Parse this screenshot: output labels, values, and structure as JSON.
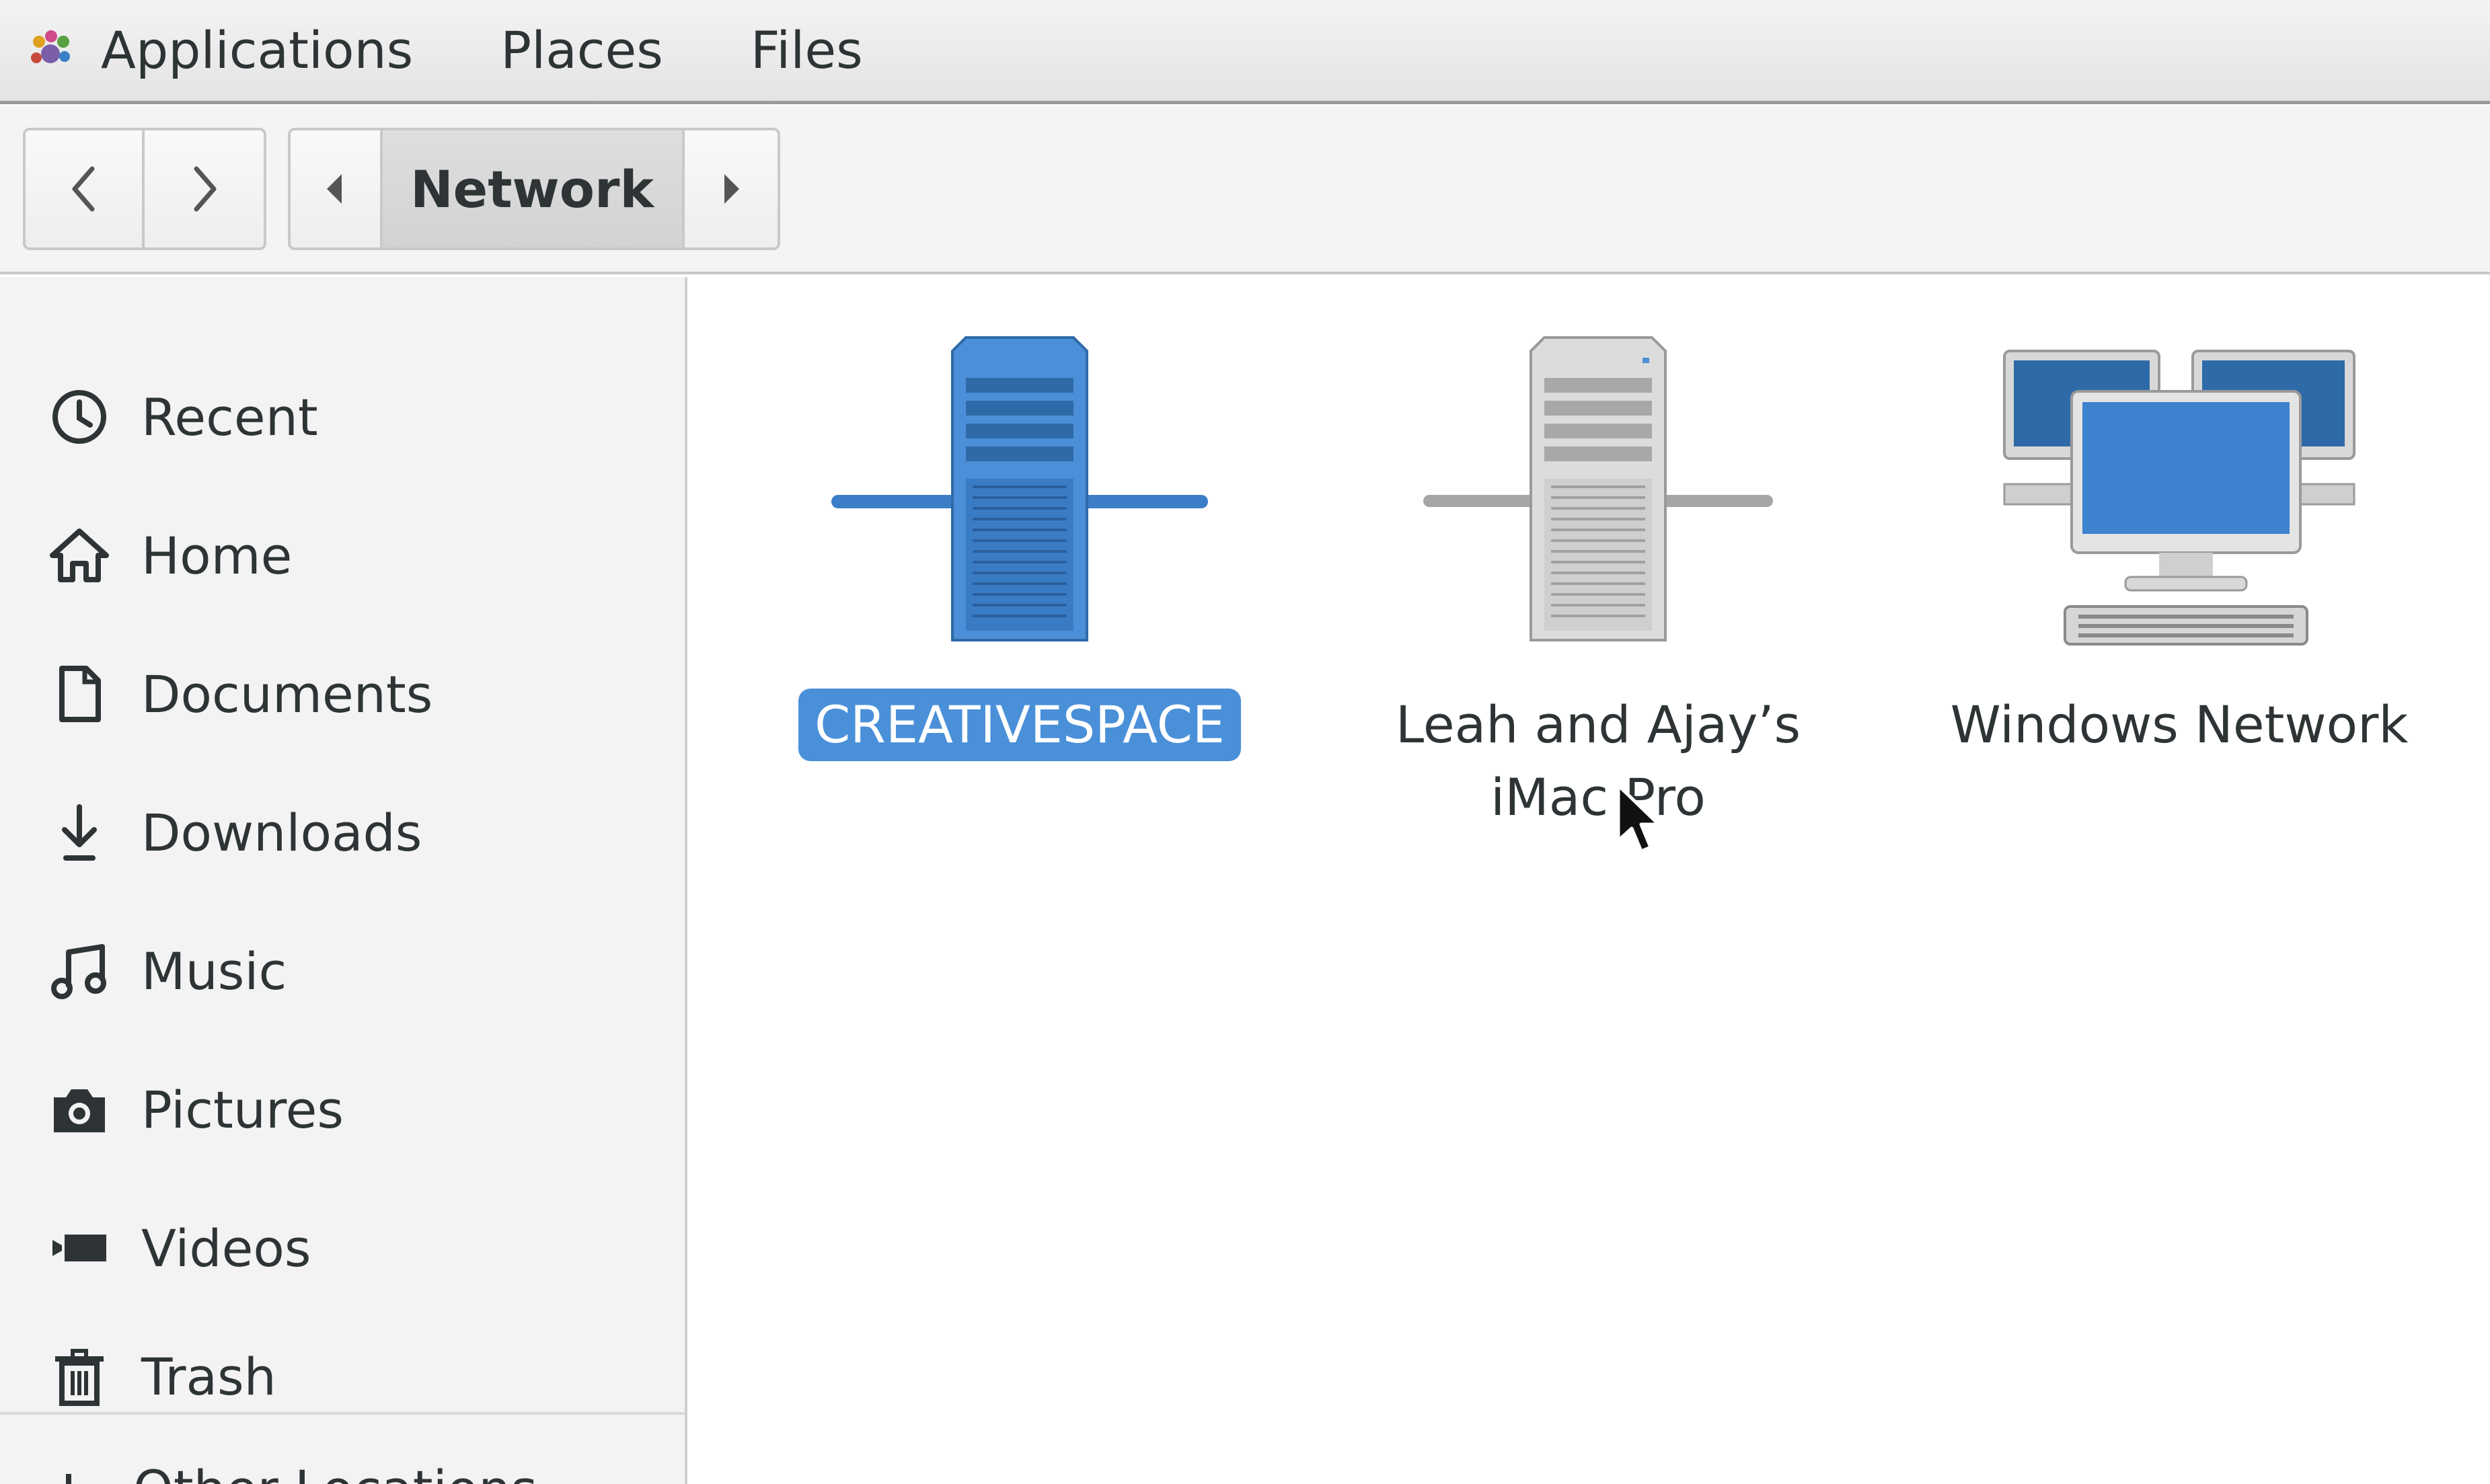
{
  "top_panel": {
    "app_icon": "gnome-foot-icon",
    "menus": [
      {
        "label": "Applications"
      },
      {
        "label": "Places"
      },
      {
        "label": "Files"
      }
    ]
  },
  "headerbar": {
    "back_icon": "chevron-left-icon",
    "forward_icon": "chevron-right-icon",
    "path_scroll_left_icon": "triangle-left-icon",
    "path_current": "Network",
    "path_scroll_right_icon": "triangle-right-icon"
  },
  "sidebar": {
    "items": [
      {
        "label": "Recent",
        "icon": "clock-icon"
      },
      {
        "label": "Home",
        "icon": "home-icon"
      },
      {
        "label": "Documents",
        "icon": "document-icon"
      },
      {
        "label": "Downloads",
        "icon": "download-icon"
      },
      {
        "label": "Music",
        "icon": "music-icon"
      },
      {
        "label": "Pictures",
        "icon": "camera-icon"
      },
      {
        "label": "Videos",
        "icon": "video-icon"
      },
      {
        "label": "Trash",
        "icon": "trash-icon"
      }
    ],
    "other_locations": "Other Locations"
  },
  "content": {
    "items": [
      {
        "label": "CREATIVESPACE",
        "icon": "network-server-icon",
        "selected": true
      },
      {
        "label": "Leah and Ajay’s iMac Pro",
        "icon": "network-server-icon",
        "selected": false
      },
      {
        "label": "Windows Network",
        "icon": "network-workgroup-icon",
        "selected": false
      }
    ]
  },
  "colors": {
    "selection": "#4a90d9",
    "sidebar_bg": "#f3f3f3",
    "text": "#2e3436"
  }
}
